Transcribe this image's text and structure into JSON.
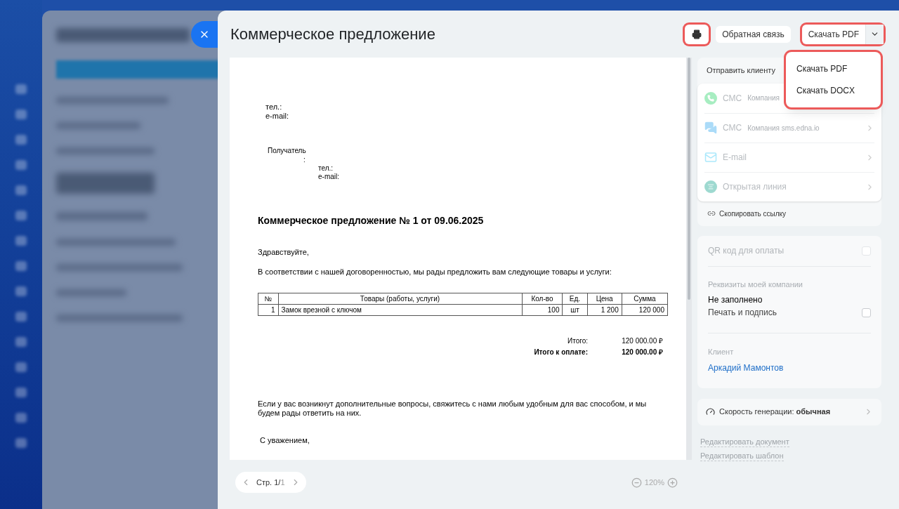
{
  "header": {
    "title": "Коммерческое предложение",
    "feedback": "Обратная связь",
    "download": "Скачать PDF"
  },
  "download_menu": {
    "open": true,
    "items": [
      "Скачать PDF",
      "Скачать DOCX"
    ]
  },
  "document": {
    "sender": [
      "тел.:",
      "e-mail:"
    ],
    "recipient_label": "Получатель",
    "recipient_colon": ":",
    "recipient": [
      "тел.:",
      "e-mail:"
    ],
    "heading": "Коммерческое предложение № 1 от 09.06.2025",
    "greeting": "Здравствуйте,",
    "intro": "В соответствии с нашей договоренностью, мы рады предложить вам следующие товары и услуги:",
    "table": {
      "columns": [
        "№",
        "Товары (работы, услуги)",
        "Кол-во",
        "Ед.",
        "Цена",
        "Сумма"
      ],
      "rows": [
        [
          "1",
          "Замок врезной с ключом",
          "100",
          "шт",
          "1 200",
          "120 000"
        ]
      ]
    },
    "totals": [
      {
        "label": "Итого:",
        "value": "120 000.00 ₽",
        "bold": false
      },
      {
        "label": "Итого к оплате:",
        "value": "120 000.00 ₽",
        "bold": true
      }
    ],
    "closing": "Если у вас возникнут дополнительные вопросы, свяжитесь с нами любым удобным для вас способом, и мы будем рады ответить на них.",
    "regards": "С уважением,"
  },
  "pagination": {
    "label": "Стр. 1/",
    "total": "1",
    "zoom": "120%"
  },
  "send": {
    "title": "Отправить клиенту",
    "channels": [
      {
        "kind": "whatsapp",
        "name": "СМС",
        "provider": "Компания",
        "disabled": true
      },
      {
        "kind": "chat",
        "name": "СМС",
        "provider": "Компания sms.edna.io",
        "disabled": true
      },
      {
        "kind": "email",
        "name": "E-mail",
        "disabled": true
      },
      {
        "kind": "openline",
        "name": "Открытая линия",
        "disabled": true
      }
    ],
    "copy_link": "Скопировать ссылку"
  },
  "options": {
    "qr": {
      "label": "QR код для оплаты",
      "checked": false,
      "disabled": true
    },
    "company_label": "Реквизиты моей компании",
    "company_value": "Не заполнено",
    "stamp": {
      "label": "Печать и подпись",
      "checked": false
    },
    "client_label": "Клиент",
    "client": "Аркадий Мамонтов"
  },
  "speed": {
    "label": "Скорость генерации:",
    "value": "обычная"
  },
  "links": [
    "Редактировать документ",
    "Редактировать шаблон"
  ]
}
